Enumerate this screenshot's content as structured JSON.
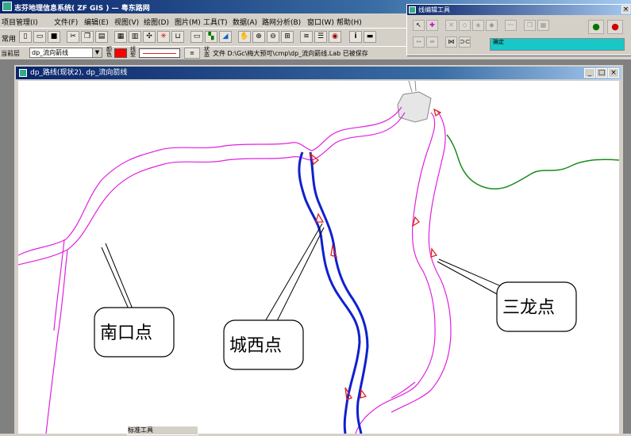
{
  "app": {
    "title": "志芬地理信息系统( ZF GIS ) — 粤东路网"
  },
  "menu": {
    "items": [
      "项目管理(I)",
      "文件(F)",
      "编辑(E)",
      "视图(V)",
      "绘图(D)",
      "图片(M)",
      "工具(T)",
      "数据(A)",
      "路网分析(B)",
      "窗口(W)",
      "帮助(H)"
    ]
  },
  "toolbar": {
    "label": "常用"
  },
  "layerbar": {
    "layer_label": "当前层",
    "layer_value": "dp_流向箭线",
    "color_label": "颜色",
    "linetype_label": "线型",
    "status_label": "状态",
    "status_text": "文件 D:\\Gc\\梅大预可\\cmp\\dp_流向箭线.Lab 已被保存"
  },
  "editpanel": {
    "title": "线编辑工具",
    "status_text": "确定"
  },
  "mapwin": {
    "title": "dp_路线(现状2), dp_流向箭线"
  },
  "callouts": {
    "nankou": "南口点",
    "chengxi": "城西点",
    "sanlong": "三龙点"
  },
  "taskbar": {
    "item": "标准工具"
  },
  "colors": {
    "magenta": "#e020e0",
    "blue": "#1020d0",
    "green": "#1a8a1a",
    "arrow": "#e02020"
  }
}
